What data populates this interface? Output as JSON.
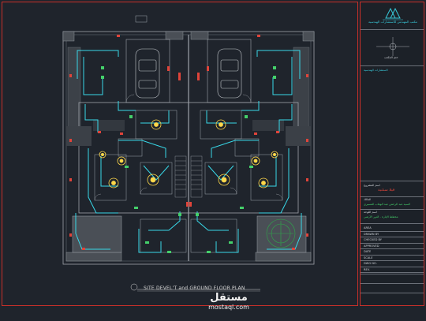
{
  "drawing": {
    "caption": "SITE DEVEL'T and GROUND FLOOR PLAN"
  },
  "title_block": {
    "firm_name": "مكتب المهندس للاستشارات الهندسية",
    "logo_caption": "الاستشارات الهندسية",
    "stamp_label": "ختم المكتب",
    "project_label": "اسم المشروع",
    "project_title": "فيلا سكنية",
    "owner_label": "المالك",
    "owner_name": "السيد عبد الرحمن عبد الوهاب المسيري",
    "drawing_label": "اسم اللوحة",
    "drawing_title": "مخطط الإنارة - الدور الأرضي",
    "rows": [
      "AREA",
      "DRAWN BY",
      "CHECKED BY",
      "APPROVED",
      "DATE",
      "SCALE",
      "DWG NO.",
      "REV."
    ]
  },
  "watermark": {
    "arabic": "مستقل",
    "latin": "mostaql.com"
  },
  "colors": {
    "background": "#1f242c",
    "frame": "#c8302a",
    "walls": "#9ea3aa",
    "circuit": "#38d8e8",
    "fixtures": "#ffd84a",
    "switches": "#44d06a",
    "outlets": "#e0443a"
  }
}
